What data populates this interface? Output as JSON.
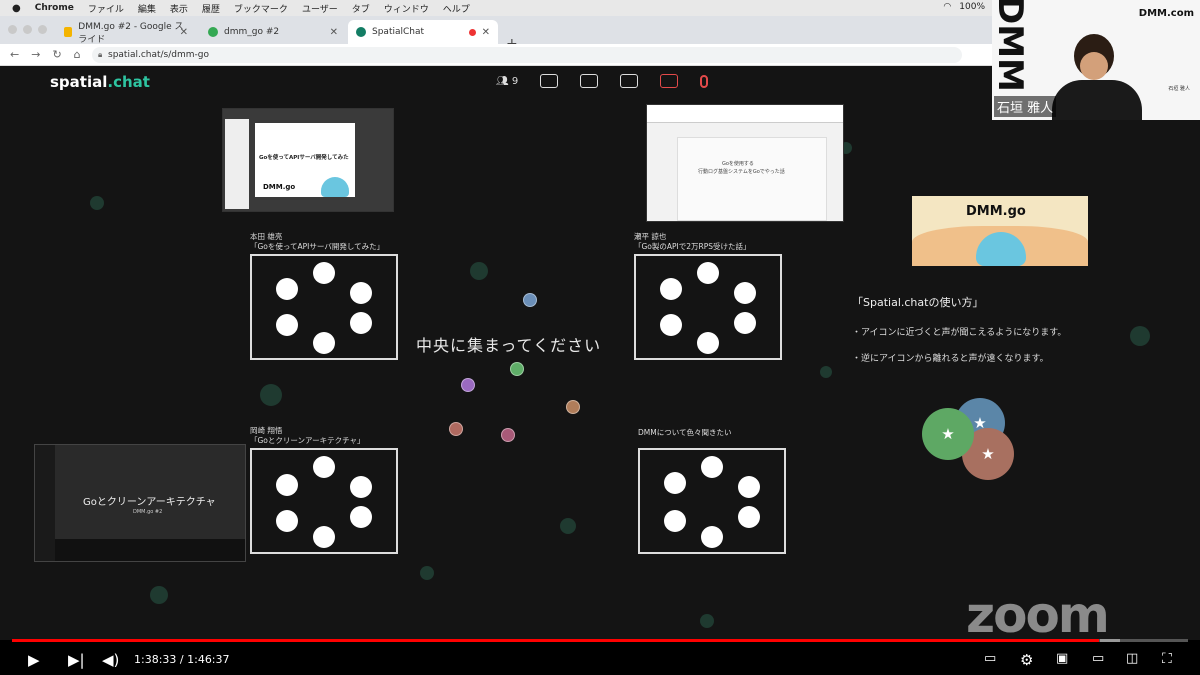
{
  "menubar": {
    "app": "Chrome",
    "items": [
      "ファイル",
      "編集",
      "表示",
      "履歴",
      "ブックマーク",
      "ユーザー",
      "タブ",
      "ウィンドウ",
      "ヘルプ"
    ],
    "battery": "100%"
  },
  "tabs": [
    {
      "title": "DMM.go #2 - Google スライド",
      "color": "#f4b400"
    },
    {
      "title": "dmm_go #2",
      "color": "#34a853"
    },
    {
      "title": "SpatialChat",
      "color": "#137d64"
    }
  ],
  "address": {
    "url": "spatial.chat/s/dmm-go"
  },
  "spatial": {
    "logo_a": "spatial",
    "logo_b": ".chat",
    "participants": "9",
    "center_text": "中央に集まってください",
    "slide1_title": "Goを使ってAPIサーバ開発してみた",
    "slide1_brand": "DMM.go",
    "slide2_title_1": "Goを使用する",
    "slide2_title_2": "行動ログ基盤システムをGoでやった話",
    "rooms": [
      {
        "label": "本田 雄亮\n「Goを使ってAPIサーバ開発してみた」"
      },
      {
        "label": "瀬平 諒也\n「Go製のAPIで2万RPS受けた話」"
      },
      {
        "label": "岡崎 翔悟\n「Goとクリーンアーキテクチャ」"
      },
      {
        "label": "DMMについて色々聞きたい"
      }
    ],
    "banner": "DMM.go",
    "howto_title": "「Spatial.chatの使い方」",
    "howto_1": "・アイコンに近づくと声が聞こえるようになります。",
    "howto_2": "・逆にアイコンから離れると声が遠くなります。",
    "bottom_slide_title": "Goとクリーンアーキテクチャ",
    "bottom_slide_sub": "DMM.go #2",
    "zoom": "zoom"
  },
  "camera": {
    "brand_vertical": "DMM",
    "brand": "DMM.com",
    "name": "石垣 雅人",
    "card": "石垣 雅人"
  },
  "player": {
    "current": "1:38:33",
    "duration": "1:46:37",
    "progress": 0.924
  }
}
